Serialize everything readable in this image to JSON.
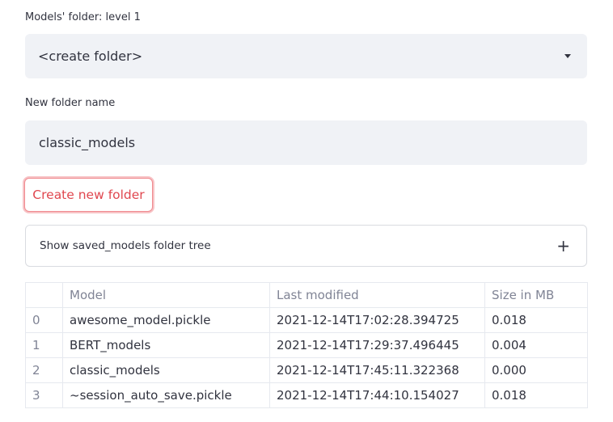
{
  "folder_select": {
    "label": "Models' folder: level 1",
    "selected": "<create folder>"
  },
  "new_folder": {
    "label": "New folder name",
    "value": "classic_models"
  },
  "create_button": {
    "label": "Create new folder"
  },
  "expander": {
    "label": "Show saved_models folder tree",
    "toggle_symbol": "+"
  },
  "table": {
    "columns": [
      "",
      "Model",
      "Last modified",
      "Size in MB"
    ],
    "rows": [
      {
        "index": "0",
        "model": "awesome_model.pickle",
        "modified": "2021-12-14T17:02:28.394725",
        "size": "0.018"
      },
      {
        "index": "1",
        "model": "BERT_models",
        "modified": "2021-12-14T17:29:37.496445",
        "size": "0.004"
      },
      {
        "index": "2",
        "model": "classic_models",
        "modified": "2021-12-14T17:45:11.322368",
        "size": "0.000"
      },
      {
        "index": "3",
        "model": "~session_auto_save.pickle",
        "modified": "2021-12-14T17:44:10.154027",
        "size": "0.018"
      }
    ]
  },
  "colors": {
    "input_bg": "#f0f2f6",
    "text": "#31333f",
    "muted": "#808495",
    "accent": "#e0474f",
    "border": "#e6e9ef"
  },
  "icons": {
    "select_caret": "caret-down-icon",
    "expander_toggle": "plus-icon"
  }
}
